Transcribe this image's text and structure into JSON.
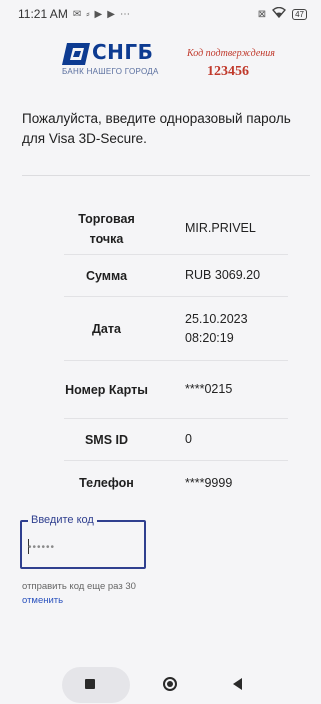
{
  "status_bar": {
    "time": "11:21 AM",
    "left_icons": [
      "notification-icon",
      "usb-icon",
      "play-icon",
      "play-icon",
      "more-icon"
    ],
    "right_icons": [
      "sim-icon",
      "wifi-icon"
    ],
    "battery_level": "47"
  },
  "brand": {
    "logo_text": "СНГБ",
    "logo_subtitle": "БАНК НАШЕГО ГОРОДА",
    "brand_color": "#0d3b91"
  },
  "confirmation_code": {
    "label": "Код подтверждения",
    "value": "123456",
    "color": "#c0392b"
  },
  "instruction": "Пожалуйста, введите одноразовый пароль для Visa 3D-Secure.",
  "details": [
    {
      "label": "Торговая точка",
      "value": "MIR.PRIVEL"
    },
    {
      "label": "Сумма",
      "value": "RUB 3069.20"
    },
    {
      "label": "Дата",
      "value": "25.10.2023 08:20:19"
    },
    {
      "label": "Номер Карты",
      "value": "****0215"
    },
    {
      "label": "SMS ID",
      "value": "0"
    },
    {
      "label": "Телефон",
      "value": "****9999"
    }
  ],
  "code_input": {
    "legend": "Введите код",
    "placeholder": "••••••",
    "value": ""
  },
  "resend_text": "отправить код еще раз 30",
  "cancel_link": "отменить",
  "nav_bar": {
    "recents_icon": "square-icon",
    "home_icon": "circle-icon",
    "back_icon": "triangle-back-icon"
  }
}
